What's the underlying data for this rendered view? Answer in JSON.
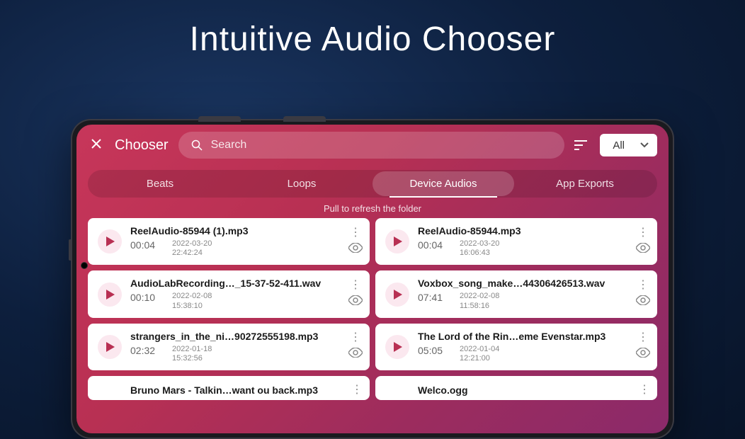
{
  "hero": {
    "title": "Intuitive Audio Chooser"
  },
  "topbar": {
    "app_title": "Chooser",
    "search_placeholder": "Search",
    "filter_value": "All"
  },
  "tabs": [
    {
      "label": "Beats",
      "active": false
    },
    {
      "label": "Loops",
      "active": false
    },
    {
      "label": "Device Audios",
      "active": true
    },
    {
      "label": "App Exports",
      "active": false
    }
  ],
  "refresh_hint": "Pull to refresh the folder",
  "files": [
    {
      "name": "ReelAudio-85944 (1).mp3",
      "duration": "00:04",
      "date": "2022-03-20",
      "time": "22:42:24"
    },
    {
      "name": "ReelAudio-85944.mp3",
      "duration": "00:04",
      "date": "2022-03-20",
      "time": "16:06:43"
    },
    {
      "name": "AudioLabRecording…_15-37-52-411.wav",
      "duration": "00:10",
      "date": "2022-02-08",
      "time": "15:38:10"
    },
    {
      "name": "Voxbox_song_make…44306426513.wav",
      "duration": "07:41",
      "date": "2022-02-08",
      "time": "11:58:16"
    },
    {
      "name": "strangers_in_the_ni…90272555198.mp3",
      "duration": "02:32",
      "date": "2022-01-18",
      "time": "15:32:56"
    },
    {
      "name": "The Lord of the Rin…eme Evenstar.mp3",
      "duration": "05:05",
      "date": "2022-01-04",
      "time": "12:21:00"
    },
    {
      "name": "Bruno Mars - Talkin…want ou back.mp3",
      "duration": "",
      "date": "",
      "time": ""
    },
    {
      "name": "Welco.ogg",
      "duration": "",
      "date": "",
      "time": ""
    }
  ]
}
